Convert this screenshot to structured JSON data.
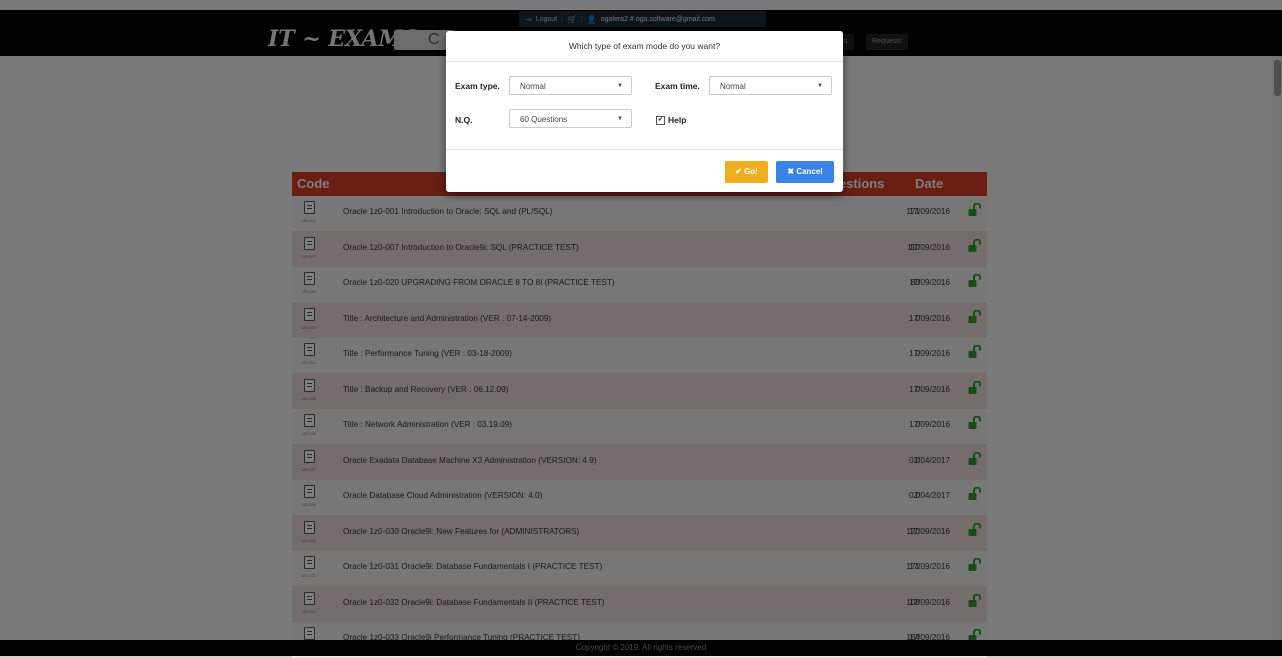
{
  "userbar": {
    "logout": "Logout",
    "email": "ogalera2 # oga.software@gmail.com"
  },
  "header": {
    "logo": "IT ~ EXAMS",
    "search_letter": "C",
    "tab_s": "s",
    "tab_requests": "Requests"
  },
  "table": {
    "headers": {
      "code": "Code",
      "questions": "uestions",
      "date": "Date"
    },
    "rows": [
      {
        "code": "1Z0-001",
        "title": "Oracle 1z0-001 Introduction to Oracle: SQL and (PL/SQL)",
        "questions": "171",
        "date": "17/09/2016"
      },
      {
        "code": "1Z0-007",
        "title": "Oracle 1z0-007 Introduction to Oracle9i: SQL (PRACTICE TEST)",
        "questions": "110",
        "date": "17/09/2016"
      },
      {
        "code": "1Z0-020",
        "title": "Oracle 1z0-020 UPGRADING FROM ORACLE 8 TO 8I (PRACTICE TEST)",
        "questions": "83",
        "date": "17/09/2016"
      },
      {
        "code": "1Z0-023",
        "title": "Title : Architecture and Administration (VER : 07-14-2009)",
        "questions": "0",
        "date": "17/09/2016"
      },
      {
        "code": "1Z0-024",
        "title": "Title : Performance Tuning (VER : 03-18-2009)",
        "questions": "0",
        "date": "17/09/2016"
      },
      {
        "code": "1Z0-025",
        "title": "Title : Backup and Recovery (VER : 06.12.09)",
        "questions": "0",
        "date": "17/09/2016"
      },
      {
        "code": "1Z0-026",
        "title": "Title : Network Administration (VER : 03.19.09)",
        "questions": "0",
        "date": "17/09/2016"
      },
      {
        "code": "1Z0-027",
        "title": "Oracle Exadata Database Machine X3 Administration (VERSION: 4.9)",
        "questions": "0",
        "date": "02/04/2017"
      },
      {
        "code": "1Z0-028",
        "title": "Oracle Database Cloud Administration (VERSION: 4.0)",
        "questions": "0",
        "date": "02/04/2017"
      },
      {
        "code": "1Z0-030",
        "title": "Oracle 1z0-030 Oracle9i: New Features for (ADMINISTRATORS)",
        "questions": "120",
        "date": "17/09/2016"
      },
      {
        "code": "1Z0-031",
        "title": "Oracle 1z0-031 Oracle9i: Database Fundamentals I (PRACTICE TEST)",
        "questions": "171",
        "date": "17/09/2016"
      },
      {
        "code": "1Z0-032",
        "title": "Oracle 1z0-032 Oracle9i: Database Fundamentals II (PRACTICE TEST)",
        "questions": "108",
        "date": "17/09/2016"
      },
      {
        "code": "1Z0-033",
        "title": "Oracle 1z0-033 Oracle9i Performance Tuning (PRACTICE TEST)",
        "questions": "164",
        "date": "17/09/2016"
      }
    ]
  },
  "footer": {
    "copyright": "Copyright © 2019. All rights reserved"
  },
  "modal": {
    "title": "Which type of exam mode do you want?",
    "exam_type_label": "Exam type.",
    "exam_type_value": "Normal",
    "exam_time_label": "Exam time.",
    "exam_time_value": "Normal",
    "nq_label": "N.Q.",
    "nq_value": "60 Questions",
    "help_label": "Help",
    "go_label": "✔ Go!",
    "cancel_label": "✖ Cancel"
  },
  "colors": {
    "header_red": "#d23a26",
    "lock_green": "#2e9d2e",
    "go_button": "#f0ad1e",
    "cancel_button": "#3a81e8"
  }
}
